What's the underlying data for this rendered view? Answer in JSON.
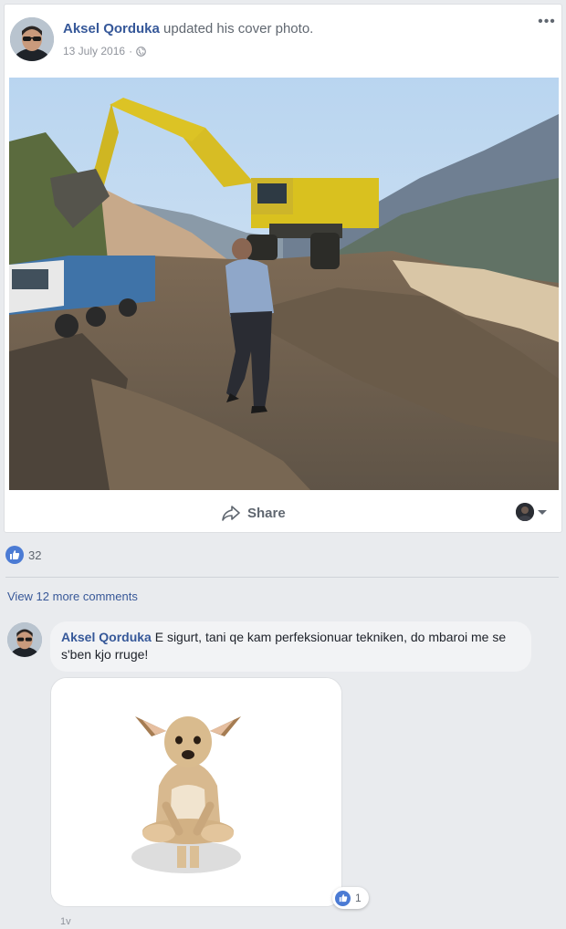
{
  "post": {
    "author": "Aksel Qorduka",
    "action": "updated his cover photo.",
    "date": "13 July 2016",
    "date_separator": "·",
    "privacy_icon": "globe-icon",
    "options_icon": "more-options-icon",
    "photo_description_icon": "photo",
    "share_label": "Share",
    "share_icon": "share-arrow-icon"
  },
  "reactions": {
    "icon": "like-icon",
    "count": "32"
  },
  "comments": {
    "view_more_label": "View 12 more comments",
    "items": [
      {
        "author": "Aksel Qorduka",
        "text": "E sigurt, tani qe kam perfeksionuar tekniken, do mbaroi me se s'ben kjo rruge!",
        "reaction_count": "1",
        "time": "1v"
      }
    ]
  },
  "colors": {
    "link": "#365899",
    "like": "#4b7bd4",
    "background": "#e9ebee"
  }
}
